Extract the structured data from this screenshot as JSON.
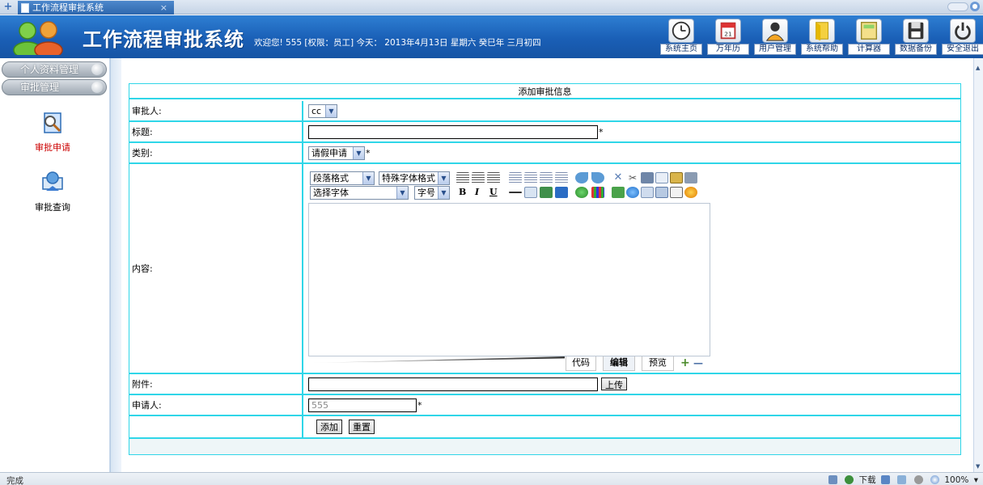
{
  "browser": {
    "tab_title": "工作流程审批系统",
    "tab_close": "×",
    "new_tab": "+"
  },
  "header": {
    "title": "工作流程审批系统",
    "welcome": "欢迎您! 555 [权限：员工] 今天： 2013年4月13日 星期六 癸巳年 三月初四"
  },
  "nav": [
    {
      "label": "系统主页",
      "icon": "clock-icon"
    },
    {
      "label": "万年历",
      "icon": "calendar-icon"
    },
    {
      "label": "用户管理",
      "icon": "user-icon"
    },
    {
      "label": "系统帮助",
      "icon": "help-icon"
    },
    {
      "label": "计算器",
      "icon": "calculator-icon"
    },
    {
      "label": "数据备份",
      "icon": "floppy-icon"
    },
    {
      "label": "安全退出",
      "icon": "power-icon"
    }
  ],
  "sidebar": {
    "menus": [
      "个人资料管理",
      "审批管理"
    ],
    "items": [
      {
        "label": "审批申请",
        "active": true
      },
      {
        "label": "审批查询",
        "active": false
      }
    ]
  },
  "form": {
    "title": "添加审批信息",
    "approver_label": "审批人:",
    "approver_value": "cc",
    "subject_label": "标题:",
    "subject_value": "",
    "category_label": "类别:",
    "category_value": "请假申请",
    "content_label": "内容:",
    "attachment_label": "附件:",
    "upload_button": "上传",
    "applicant_label": "申请人:",
    "applicant_value": "555",
    "add_button": "添加",
    "reset_button": "重置",
    "required_mark": "*"
  },
  "editor": {
    "paragraph_format": "段落格式",
    "special_format": "特殊字体格式",
    "font": "选择字体",
    "font_size": "字号",
    "bold": "B",
    "italic": "I",
    "underline": "U",
    "tabs": [
      "代码",
      "编辑",
      "预览"
    ],
    "plus": "+",
    "minus": "—"
  },
  "status": {
    "text": "完成",
    "download": "下载",
    "zoom": "100%"
  },
  "colors": {
    "border": "#2fd6e8",
    "header": "#1a5fb6",
    "active_link": "#cc0000"
  }
}
